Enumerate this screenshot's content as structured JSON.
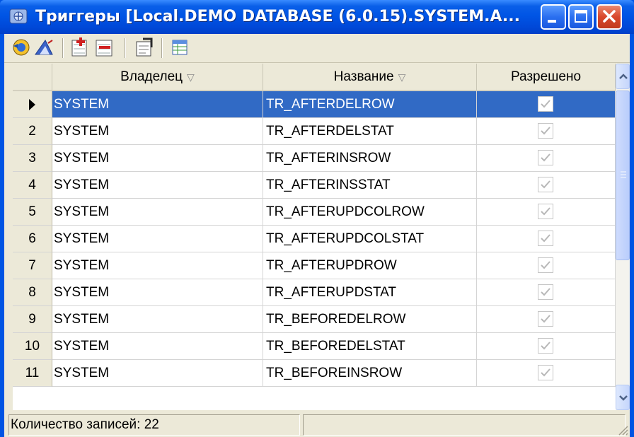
{
  "window": {
    "title": "Триггеры [Local.DEMO DATABASE (6.0.15).SYSTEM.A...",
    "accent": "#0054e3",
    "selection": "#316ac5"
  },
  "toolbar": {
    "icons": [
      "refresh-icon",
      "filter-icon",
      "add-trigger-icon",
      "delete-trigger-icon",
      "properties-icon",
      "columns-icon"
    ]
  },
  "grid": {
    "columns": [
      {
        "label": "Владелец",
        "sort": "▽"
      },
      {
        "label": "Название",
        "sort": "▽"
      },
      {
        "label": "Разрешено",
        "sort": ""
      }
    ],
    "rows": [
      {
        "ind": "",
        "owner": "SYSTEM",
        "name": "TR_AFTERDELROW",
        "enabled": true,
        "selected": true
      },
      {
        "ind": "2",
        "owner": "SYSTEM",
        "name": "TR_AFTERDELSTAT",
        "enabled": true
      },
      {
        "ind": "3",
        "owner": "SYSTEM",
        "name": "TR_AFTERINSROW",
        "enabled": true
      },
      {
        "ind": "4",
        "owner": "SYSTEM",
        "name": "TR_AFTERINSSTAT",
        "enabled": true
      },
      {
        "ind": "5",
        "owner": "SYSTEM",
        "name": "TR_AFTERUPDCOLROW",
        "enabled": true
      },
      {
        "ind": "6",
        "owner": "SYSTEM",
        "name": "TR_AFTERUPDCOLSTAT",
        "enabled": true
      },
      {
        "ind": "7",
        "owner": "SYSTEM",
        "name": "TR_AFTERUPDROW",
        "enabled": true
      },
      {
        "ind": "8",
        "owner": "SYSTEM",
        "name": "TR_AFTERUPDSTAT",
        "enabled": true
      },
      {
        "ind": "9",
        "owner": "SYSTEM",
        "name": "TR_BEFOREDELROW",
        "enabled": true
      },
      {
        "ind": "10",
        "owner": "SYSTEM",
        "name": "TR_BEFOREDELSTAT",
        "enabled": true
      },
      {
        "ind": "11",
        "owner": "SYSTEM",
        "name": "TR_BEFOREINSROW",
        "enabled": true
      }
    ]
  },
  "status": {
    "count_text": "Количество записей: 22",
    "second_panel": ""
  }
}
